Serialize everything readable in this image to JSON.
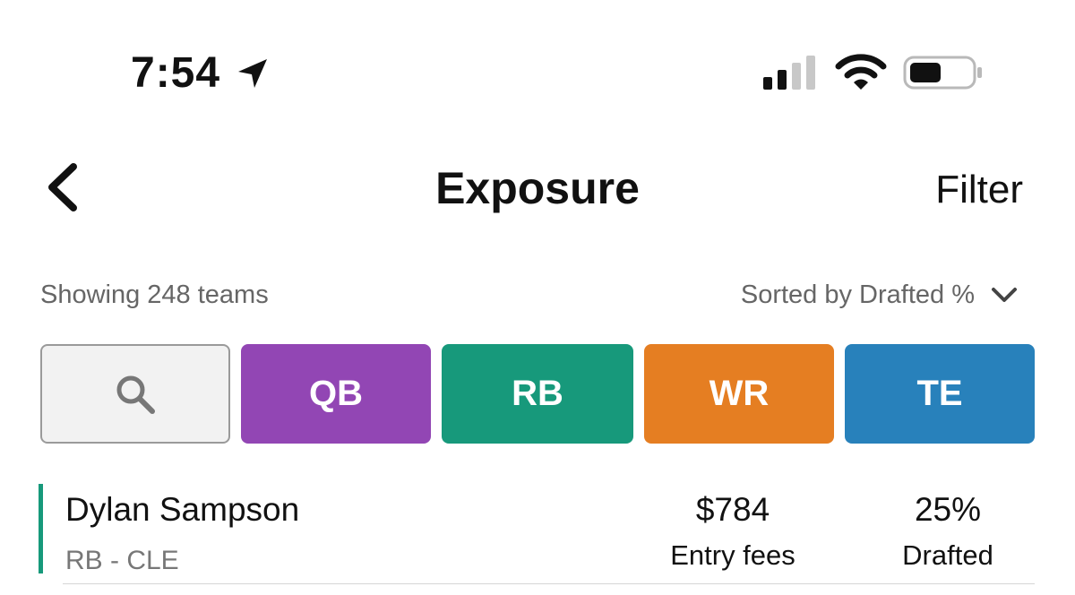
{
  "status_bar": {
    "time": "7:54",
    "icons": [
      "location-arrow-icon",
      "signal-icon",
      "wifi-icon",
      "battery-icon"
    ]
  },
  "nav": {
    "title": "Exposure",
    "filter_label": "Filter",
    "back_icon": "chevron-left-icon"
  },
  "summary": {
    "showing_text": "Showing 248 teams",
    "sorted_text": "Sorted by Drafted %",
    "sort_icon": "chevron-down-icon"
  },
  "position_filters": {
    "search_icon": "search-icon",
    "buttons": [
      {
        "label": "QB",
        "color": "#9246b4"
      },
      {
        "label": "RB",
        "color": "#17997b"
      },
      {
        "label": "WR",
        "color": "#e57e22"
      },
      {
        "label": "TE",
        "color": "#2881bb"
      }
    ]
  },
  "players": [
    {
      "name": "Dylan Sampson",
      "meta": "RB - CLE",
      "accent_color": "#17997b",
      "entry_fees": "$784",
      "entry_fees_label": "Entry fees",
      "drafted": "25%",
      "drafted_label": "Drafted"
    }
  ]
}
